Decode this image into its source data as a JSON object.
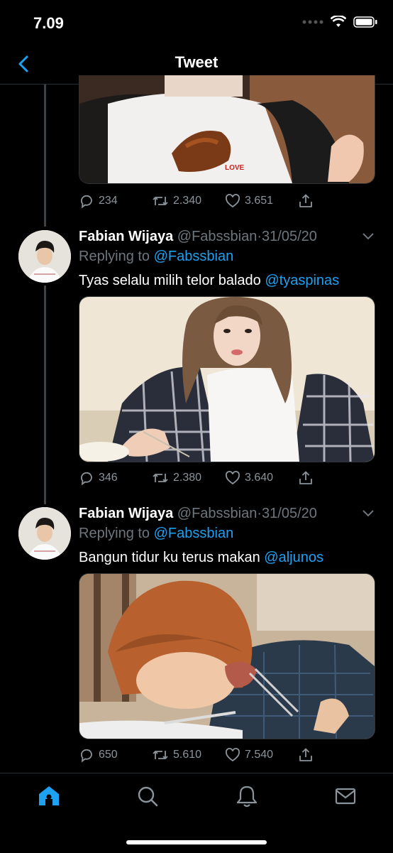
{
  "status_bar": {
    "time": "7.09"
  },
  "nav": {
    "title": "Tweet"
  },
  "tweets": [
    {
      "reply_count": "234",
      "retweet_count": "2.340",
      "like_count": "3.651"
    },
    {
      "name": "Fabian Wijaya",
      "handle": "@Fabssbian",
      "separator": "·",
      "date": "31/05/20",
      "replying_label": "Replying to",
      "replying_to": "@Fabssbian",
      "text": "Tyas selalu milih telor balado",
      "mention": "@tyaspinas",
      "reply_count": "346",
      "retweet_count": "2.380",
      "like_count": "3.640"
    },
    {
      "name": "Fabian Wijaya",
      "handle": "@Fabssbian",
      "separator": "·",
      "date": "31/05/20",
      "replying_label": "Replying to",
      "replying_to": "@Fabssbian",
      "text": "Bangun tidur ku terus makan",
      "mention": "@aljunos",
      "reply_count": "650",
      "retweet_count": "5.610",
      "like_count": "7.540"
    }
  ],
  "image_text": {
    "shirt_label": "LOVE"
  },
  "icons": {
    "back": "chevron-left-icon",
    "reply": "reply-icon",
    "retweet": "retweet-icon",
    "like": "heart-icon",
    "share": "share-icon",
    "tabs": [
      "home-icon",
      "search-icon",
      "bell-icon",
      "mail-icon"
    ]
  },
  "colors": {
    "accent": "#1da1f2",
    "secondary_text": "#6e767d",
    "background": "#000000"
  }
}
